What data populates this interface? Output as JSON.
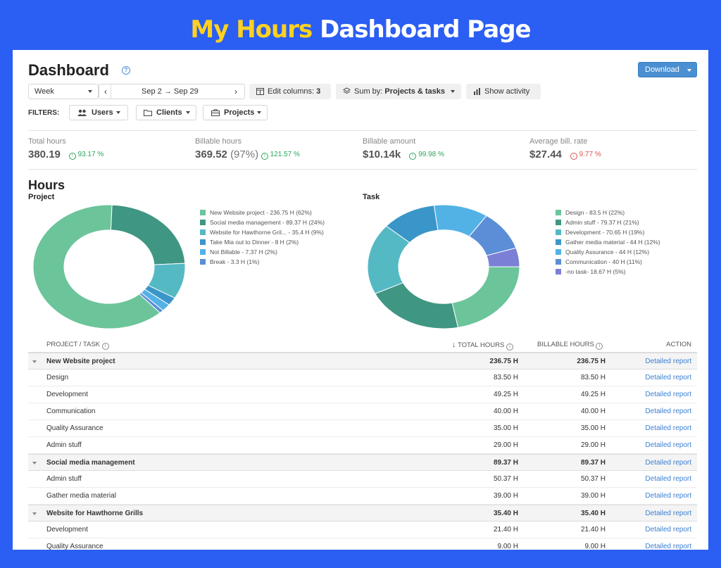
{
  "banner": {
    "accent": "My Hours",
    "rest": "Dashboard Page"
  },
  "page": {
    "title": "Dashboard",
    "help_icon": "?",
    "download_label": "Download"
  },
  "toolbar": {
    "period": "Week",
    "range_start": "Sep 2",
    "range_arrow": "→",
    "range_end": "Sep 29",
    "edit_columns_label": "Edit columns:",
    "edit_columns_count": "3",
    "sum_by_label": "Sum by:",
    "sum_by_value": "Projects & tasks",
    "show_activity_label": "Show activity"
  },
  "filters": {
    "label": "FILTERS:",
    "users": "Users",
    "clients": "Clients",
    "projects": "Projects"
  },
  "stats": [
    {
      "label": "Total hours",
      "value": "380.19",
      "extra": "",
      "change": "93.17 %",
      "direction": "up"
    },
    {
      "label": "Billable hours",
      "value": "369.52",
      "extra": "(97%)",
      "change": "121.57 %",
      "direction": "up"
    },
    {
      "label": "Billable amount",
      "value": "$10.14k",
      "extra": "",
      "change": "99.98 %",
      "direction": "up"
    },
    {
      "label": "Average bill. rate",
      "value": "$27.44",
      "extra": "",
      "change": "9.77 %",
      "direction": "down"
    }
  ],
  "hours": {
    "heading": "Hours",
    "project_chart": {
      "label": "Project",
      "slices": [
        {
          "label": "New Website project - 236.75 H (62%)",
          "value": 236.75,
          "color": "#6cc49b"
        },
        {
          "label": "Social media management - 89.37 H (24%)",
          "value": 89.37,
          "color": "#3f9682"
        },
        {
          "label": "Website for Hawthorne Gril... - 35.4 H (9%)",
          "value": 35.4,
          "color": "#55b9c4"
        },
        {
          "label": "Take Mia out to Dinner - 8 H (2%)",
          "value": 8,
          "color": "#3a96c8"
        },
        {
          "label": "Not Billable - 7.37 H (2%)",
          "value": 7.37,
          "color": "#52b2e6"
        },
        {
          "label": "Break - 3.3 H (1%)",
          "value": 3.3,
          "color": "#5b8ed6"
        }
      ]
    },
    "task_chart": {
      "label": "Task",
      "slices": [
        {
          "label": "Design - 83.5 H (22%)",
          "value": 83.5,
          "color": "#6cc49b"
        },
        {
          "label": "Admin stuff - 79.37 H (21%)",
          "value": 79.37,
          "color": "#3f9682"
        },
        {
          "label": "Development - 70.65 H (19%)",
          "value": 70.65,
          "color": "#55b9c4"
        },
        {
          "label": "Gather media material - 44 H (12%)",
          "value": 44,
          "color": "#3a96c8"
        },
        {
          "label": "Quality Assurance - 44 H (12%)",
          "value": 44,
          "color": "#52b2e6"
        },
        {
          "label": "Communication - 40 H (11%)",
          "value": 40,
          "color": "#5b8ed6"
        },
        {
          "label": "-no task- 18.67 H (5%)",
          "value": 18.67,
          "color": "#7b7fd6"
        }
      ]
    }
  },
  "table": {
    "col_project": "PROJECT / TASK",
    "col_total": "TOTAL HOURS",
    "col_billable": "BILLABLE HOURS",
    "col_action": "ACTION",
    "sort_icon": "↓",
    "info_icon": "i",
    "rows": [
      {
        "name": "New Website project",
        "total": "236.75 H",
        "billable": "236.75 H",
        "action": "Detailed report",
        "group": true
      },
      {
        "name": "Design",
        "total": "83.50 H",
        "billable": "83.50 H",
        "action": "Detailed report",
        "group": false
      },
      {
        "name": "Development",
        "total": "49.25 H",
        "billable": "49.25 H",
        "action": "Detailed report",
        "group": false
      },
      {
        "name": "Communication",
        "total": "40.00 H",
        "billable": "40.00 H",
        "action": "Detailed report",
        "group": false
      },
      {
        "name": "Quality Assurance",
        "total": "35.00 H",
        "billable": "35.00 H",
        "action": "Detailed report",
        "group": false
      },
      {
        "name": "Admin stuff",
        "total": "29.00 H",
        "billable": "29.00 H",
        "action": "Detailed report",
        "group": false
      },
      {
        "name": "Social media management",
        "total": "89.37 H",
        "billable": "89.37 H",
        "action": "Detailed report",
        "group": true
      },
      {
        "name": "Admin stuff",
        "total": "50.37 H",
        "billable": "50.37 H",
        "action": "Detailed report",
        "group": false
      },
      {
        "name": "Gather media material",
        "total": "39.00 H",
        "billable": "39.00 H",
        "action": "Detailed report",
        "group": false
      },
      {
        "name": "Website for Hawthorne Grills",
        "total": "35.40 H",
        "billable": "35.40 H",
        "action": "Detailed report",
        "group": true
      },
      {
        "name": "Development",
        "total": "21.40 H",
        "billable": "21.40 H",
        "action": "Detailed report",
        "group": false
      },
      {
        "name": "Quality Assurance",
        "total": "9.00 H",
        "billable": "9.00 H",
        "action": "Detailed report",
        "group": false
      }
    ]
  }
}
